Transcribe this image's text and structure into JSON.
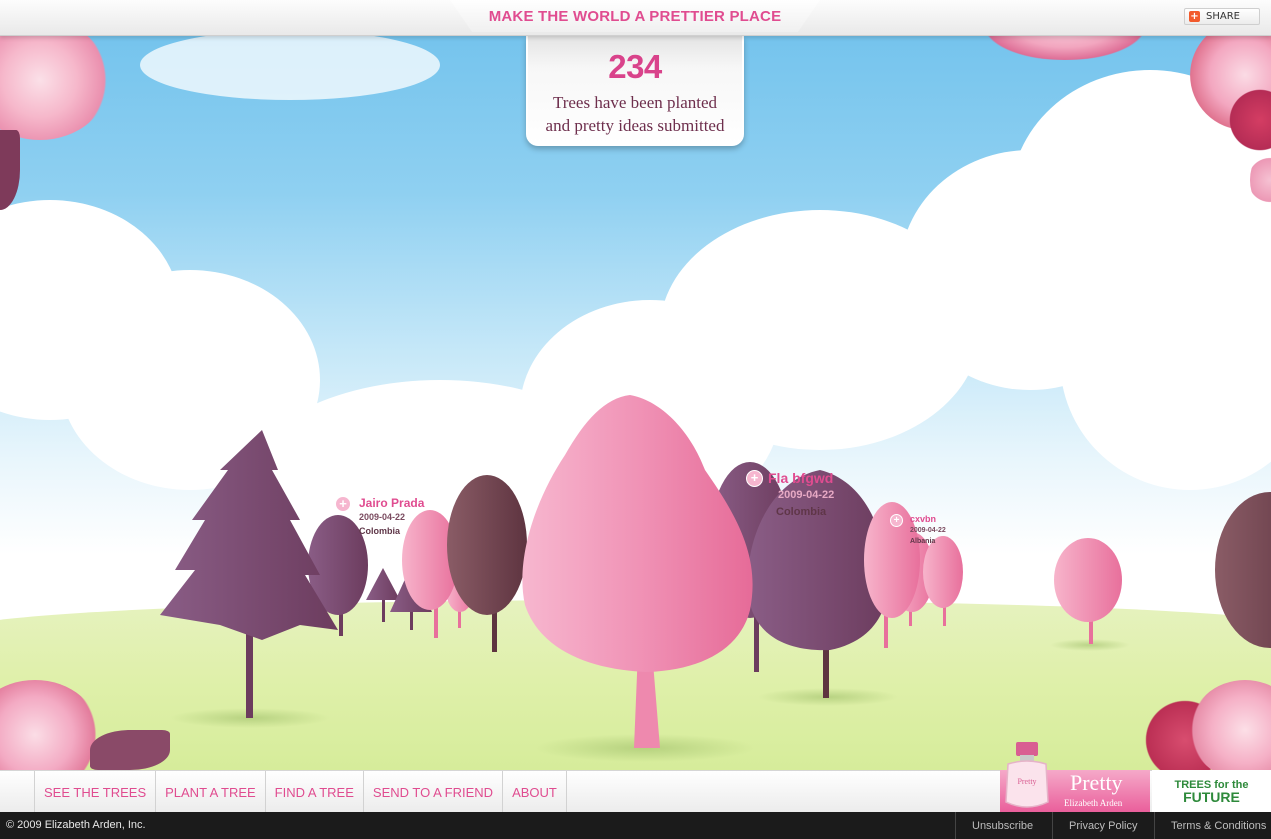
{
  "header": {
    "title": "MAKE THE WORLD A PRETTIER PLACE",
    "share_label": "SHARE",
    "share_icon": "plus-share-icon"
  },
  "counter": {
    "count": "234",
    "line1": "Trees have been planted",
    "line2": "and pretty ideas submitted"
  },
  "tree_labels": [
    {
      "name": "Jairo Prada",
      "date": "2009-04-22",
      "country": "Colombia"
    },
    {
      "name": "Fla bfgwd",
      "date": "2009-04-22",
      "country": "Colombia"
    },
    {
      "name": "cxvbn",
      "date": "2009-04-22",
      "country": "Albania"
    }
  ],
  "nav": {
    "items": [
      "SEE THE TREES",
      "PLANT A TREE",
      "FIND A TREE",
      "SEND TO A FRIEND",
      "ABOUT"
    ]
  },
  "brand": {
    "product": "Pretty",
    "maker": "Elizabeth Arden",
    "bottle_label": "Pretty",
    "partner_line1": "TREES for the",
    "partner_line2": "FUTURE"
  },
  "footer": {
    "copyright": "© 2009 Elizabeth Arden, Inc.",
    "links": [
      "Unsubscribe",
      "Privacy Policy",
      "Terms & Conditions"
    ]
  },
  "colors": {
    "accent_pink": "#e04c90",
    "plum": "#7a4a6a",
    "sky": "#8fd0f1",
    "grass": "#dff0aa"
  }
}
